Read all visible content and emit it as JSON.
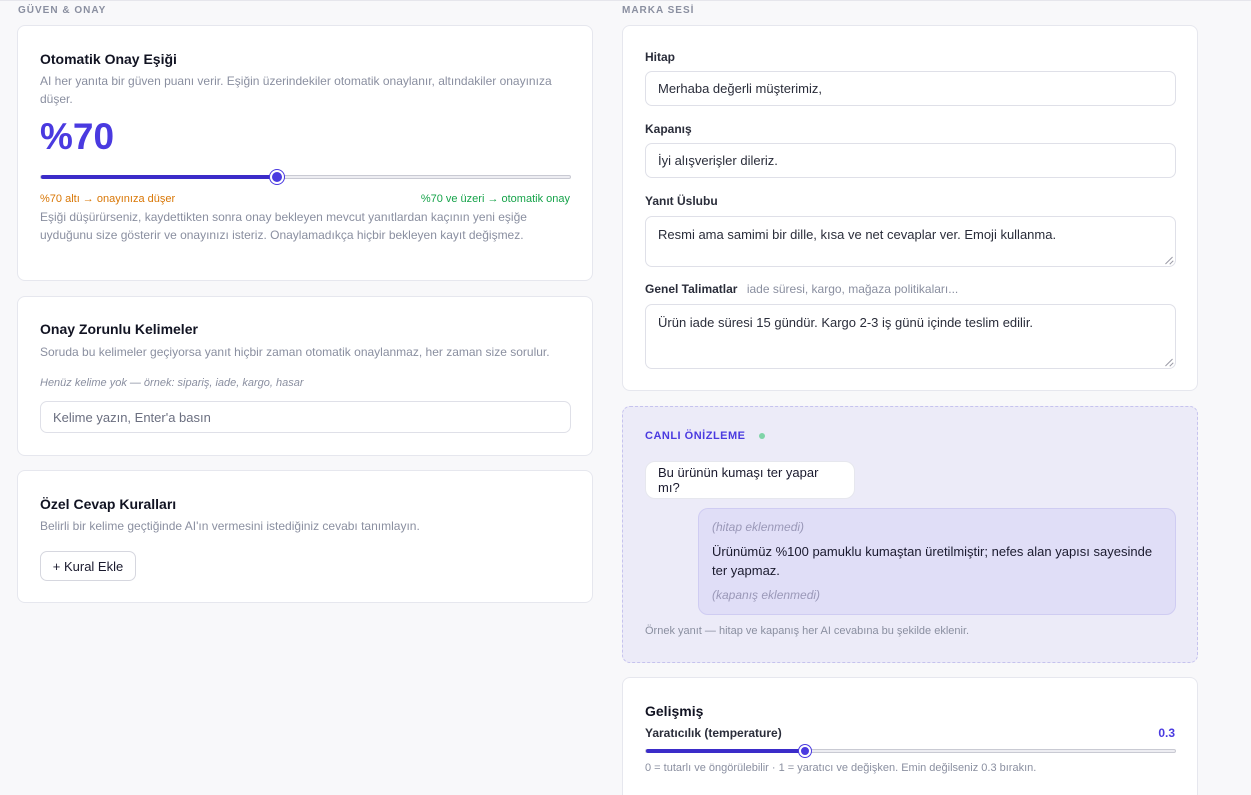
{
  "trust": {
    "section_title": "GÜVEN & ONAY",
    "threshold": {
      "title": "Otomatik Onay Eşiği",
      "description": "AI her yanıta bir güven puanı verir. Eşiğin üzerindekiler otomatik onaylanır, altındakiler onayınıza düşer.",
      "value_display": "%70",
      "value_percent": 70,
      "label_low": "%70 altı → onayınıza düşer",
      "label_high": "%70 ve üzeri → otomatik onay",
      "note": "Eşiği düşürürseniz, kaydettikten sonra onay bekleyen mevcut yanıtlardan kaçının yeni eşiğe uyduğunu size gösterir ve onayınızı isteriz. Onaylamadıkça hiçbir bekleyen kayıt değişmez."
    },
    "keywords": {
      "title": "Onay Zorunlu Kelimeler",
      "description": "Soruda bu kelimeler geçiyorsa yanıt hiçbir zaman otomatik onaylanmaz, her zaman size sorulur.",
      "empty_hint": "Henüz kelime yok — örnek: sipariş, iade, kargo, hasar",
      "input_placeholder": "Kelime yazın, Enter'a basın"
    },
    "rules": {
      "title": "Özel Cevap Kuralları",
      "description": "Belirli bir kelime geçtiğinde AI'ın vermesini istediğiniz cevabı tanımlayın.",
      "add_button": "+ Kural Ekle"
    }
  },
  "brand": {
    "section_title": "MARKA SESİ",
    "greeting_label": "Hitap",
    "greeting_value": "Merhaba değerli müşterimiz,",
    "closing_label": "Kapanış",
    "closing_value": "İyi alışverişler dileriz.",
    "style_label": "Yanıt Üslubu",
    "style_value": "Resmi ama samimi bir dille, kısa ve net cevaplar ver. Emoji kullanma.",
    "instructions_label": "Genel Talimatlar",
    "instructions_hint": "iade süresi, kargo, mağaza politikaları...",
    "instructions_value": "Ürün iade süresi 15 gündür. Kargo 2-3 iş günü içinde teslim edilir."
  },
  "preview": {
    "title": "CANLI ÖNİZLEME",
    "question": "Bu ürünün kumaşı ter yapar mı?",
    "greeting_missing": "(hitap eklenmedi)",
    "answer": "Ürünümüz %100 pamuklu kumaştan üretilmiştir; nefes alan yapısı sayesinde ter yapmaz.",
    "closing_missing": "(kapanış eklenmedi)",
    "footnote": "Örnek yanıt — hitap ve kapanış her AI cevabına bu şekilde eklenir."
  },
  "advanced": {
    "title": "Gelişmiş",
    "temperature_label": "Yaratıcılık (temperature)",
    "temperature_value": "0.3",
    "temperature_fraction": 0.3,
    "hint": "0 = tutarlı ve öngörülebilir · 1 = yaratıcı ve değişken. Emin değilseniz 0.3 bırakın."
  },
  "colors": {
    "accent": "#4a3ae0",
    "low_label": "#d97706",
    "high_label": "#16a34a",
    "preview_dot": "#7fd4a8"
  }
}
